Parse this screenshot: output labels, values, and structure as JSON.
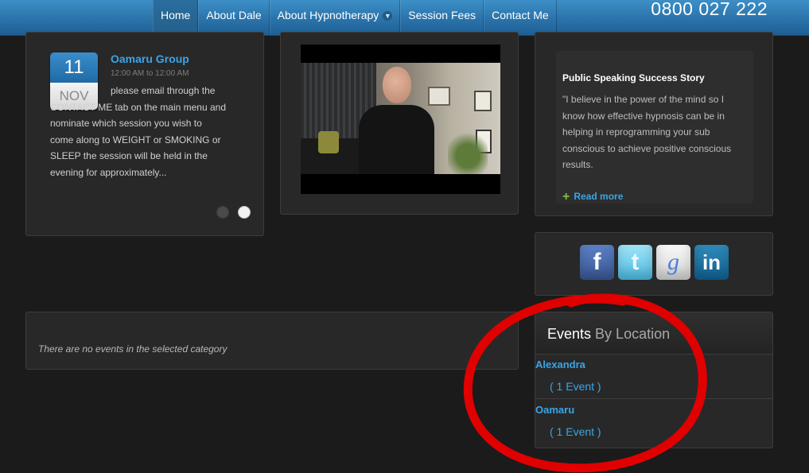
{
  "nav": {
    "items": [
      "Home",
      "About Dale",
      "About Hypnotherapy",
      "Session Fees",
      "Contact Me"
    ],
    "active": "Home",
    "dropdown_item": "About Hypnotherapy"
  },
  "phone": "0800 027 222",
  "event": {
    "day": "11",
    "month": "NOV",
    "title": "Oamaru Group",
    "time": "12:00 AM to 12:00 AM",
    "body": "please email through the CONTACT ME tab on the main menu and nominate which session you wish to come along to WEIGHT or SMOKING or SLEEP the session will be held in the evening for approximately..."
  },
  "story": {
    "title": "Public Speaking Success Story",
    "text": "\"I believe in the power of the mind so I know how effective hypnosis can be in helping in reprogramming your sub conscious to achieve positive conscious results.",
    "read_more": "Read more"
  },
  "social": {
    "facebook": "f",
    "twitter": "t",
    "google": "g",
    "linkedin": "in"
  },
  "no_events": "There are no events in the selected category",
  "locations": {
    "title_strong": "Events",
    "title_rest": "By Location",
    "items": [
      {
        "name": "Alexandra",
        "count": "( 1 Event )"
      },
      {
        "name": "Oamaru",
        "count": "( 1 Event )"
      }
    ]
  },
  "colors": {
    "accent": "#3aa5e8",
    "nav_bar": "#2a73aa",
    "annotation": "#e00000"
  }
}
